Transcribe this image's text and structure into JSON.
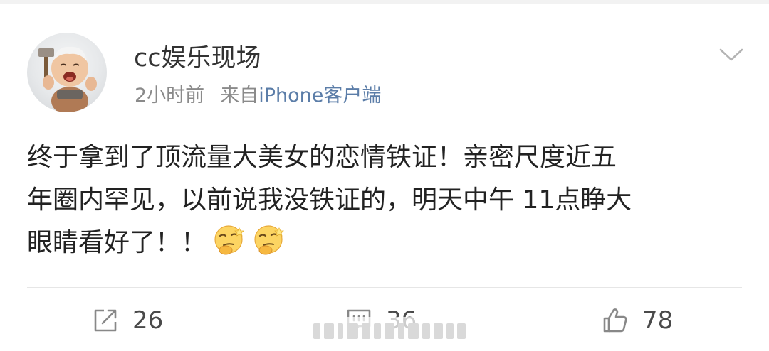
{
  "post": {
    "username": "cc娱乐现场",
    "time": "2小时前",
    "source_prefix": "来自",
    "source_name": "iPhone客户端",
    "text_lines": [
      "终于拿到了顶流量大美女的恋情铁证！亲密尺度近五",
      "年圈内罕见，以前说我没铁证的，明天中午 11点睁大",
      "眼睛看好了！！"
    ],
    "emojis": [
      "thinking-face-emoji",
      "thinking-face-emoji"
    ]
  },
  "actions": {
    "repost_count": "26",
    "comment_count": "36",
    "like_count": "78"
  },
  "icons": {
    "more": "chevron-down-icon",
    "repost": "repost-icon",
    "comment": "comment-icon",
    "like": "thumbs-up-icon"
  },
  "colors": {
    "source_link": "#5b7da8",
    "meta_text": "#8a8a8a",
    "body_text": "#222222",
    "icon_gray": "#888888"
  }
}
